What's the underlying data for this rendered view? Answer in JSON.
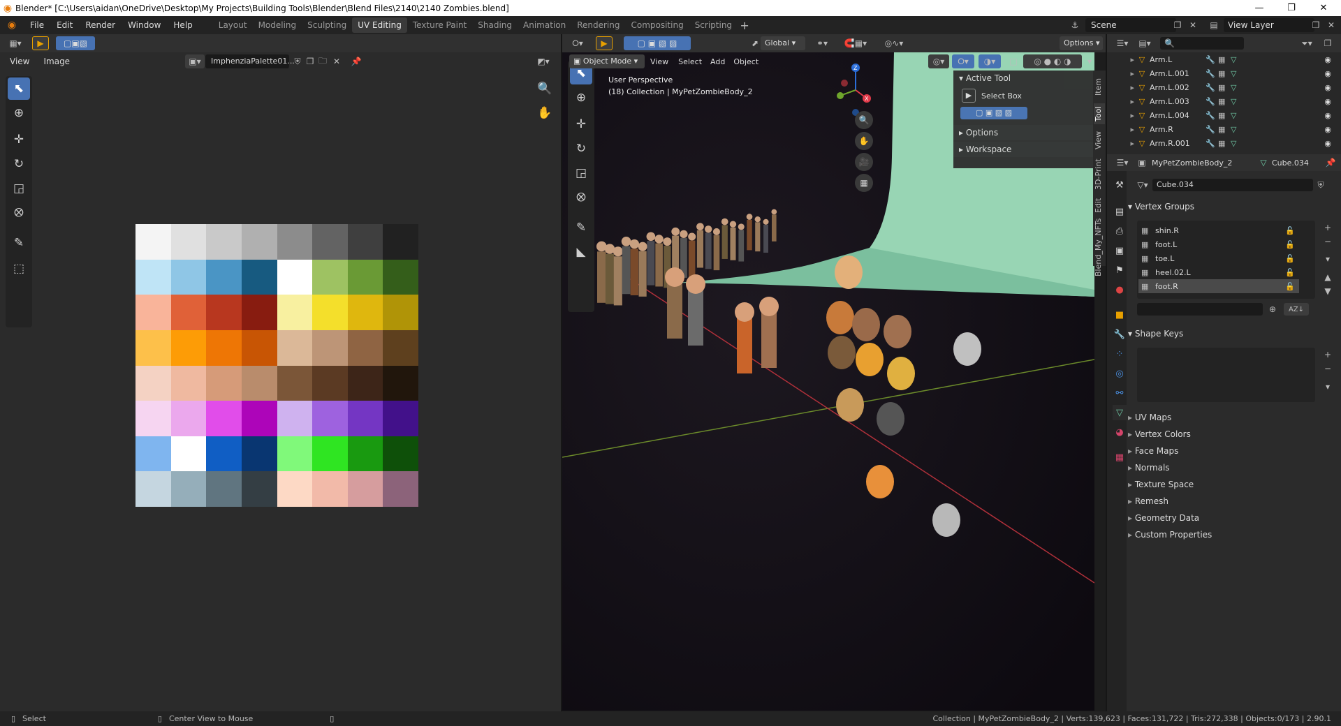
{
  "window": {
    "title": "Blender* [C:\\Users\\aidan\\OneDrive\\Desktop\\My Projects\\Building Tools\\Blender\\Blend Files\\2140\\2140 Zombies.blend]",
    "minimize_icon": "minimize-icon",
    "maximize_icon": "restore-icon",
    "close_icon": "close-icon"
  },
  "menu": [
    "File",
    "Edit",
    "Render",
    "Window",
    "Help"
  ],
  "workspaces": [
    "Layout",
    "Modeling",
    "Sculpting",
    "UV Editing",
    "Texture Paint",
    "Shading",
    "Animation",
    "Rendering",
    "Compositing",
    "Scripting"
  ],
  "active_workspace": "UV Editing",
  "add_workspace_icon": "plus-icon",
  "scene": "Scene",
  "view_layer": "View Layer",
  "image_editor": {
    "menu": [
      "View",
      "Image"
    ],
    "image_name": "ImphenziaPalette01...",
    "tools": [
      "select-box-icon",
      "cursor-icon",
      "move-icon",
      "rotate-icon",
      "scale-icon",
      "transform-icon",
      "annotate-icon",
      "grab-icon"
    ],
    "palette_colors": [
      [
        "#f4f4f4",
        "#e0e0e0",
        "#c9c9c9",
        "#b0b0b0",
        "#8c8c8c",
        "#636363",
        "#3f3f3f",
        "#212121"
      ],
      [
        "#bfe4f6",
        "#8fc6e6",
        "#4a95c5",
        "#175a80",
        "#ffffff",
        "#9ec262",
        "#6a9a35",
        "#345e1a"
      ],
      [
        "#f9b49a",
        "#e06138",
        "#b8371f",
        "#881c10",
        "#f8f0a0",
        "#f4df2b",
        "#dfb70e",
        "#b09407"
      ],
      [
        "#fdc04a",
        "#fd9c06",
        "#ee7605",
        "#c85504",
        "#dbb898",
        "#bd9577",
        "#8f6443",
        "#5e401e"
      ],
      [
        "#f4d2c3",
        "#efb9a0",
        "#d69b79",
        "#b98c6c",
        "#7b5638",
        "#5b3a23",
        "#3d2518",
        "#21160c"
      ],
      [
        "#f6d5f1",
        "#eba8ed",
        "#e14dea",
        "#ad05b9",
        "#cfb2ef",
        "#9e62df",
        "#7436c3",
        "#42118a"
      ],
      [
        "#7fb5ef",
        "#ffffff",
        "#105ec4",
        "#093671",
        "#80f97a",
        "#2fe522",
        "#199a10",
        "#0e5009"
      ],
      [
        "#c5d6e0",
        "#95aeba",
        "#607580",
        "#343e44",
        "#fdd9c5",
        "#f2baa9",
        "#d69d9e",
        "#8c637a"
      ]
    ]
  },
  "viewport": {
    "mode": "Object Mode",
    "menu": [
      "View",
      "Select",
      "Add",
      "Object"
    ],
    "orientation": "Global",
    "options_label": "Options",
    "perspective_label": "User Perspective",
    "collection_label": "(18) Collection | MyPetZombieBody_2",
    "side_tabs": [
      "Item",
      "Tool",
      "View",
      "3D-Print",
      "Edit",
      "Blend_My_NFTs"
    ],
    "active_tool_title": "Active Tool",
    "active_tool_name": "Select Box",
    "options_section": "Options",
    "workspace_section": "Workspace"
  },
  "outliner": {
    "items": [
      "Arm.L",
      "Arm.L.001",
      "Arm.L.002",
      "Arm.L.003",
      "Arm.L.004",
      "Arm.R",
      "Arm.R.001"
    ]
  },
  "properties": {
    "object_name": "MyPetZombieBody_2",
    "mesh_name": "Cube.034",
    "data_name": "Cube.034",
    "vertex_groups_title": "Vertex Groups",
    "vertex_groups": [
      "shin.R",
      "foot.L",
      "toe.L",
      "heel.02.L",
      "foot.R"
    ],
    "shape_keys_title": "Shape Keys",
    "sections": [
      "UV Maps",
      "Vertex Colors",
      "Face Maps",
      "Normals",
      "Texture Space",
      "Remesh",
      "Geometry Data",
      "Custom Properties"
    ]
  },
  "status": {
    "select": "Select",
    "center_view": "Center View to Mouse",
    "stats": "Collection | MyPetZombieBody_2 | Verts:139,623 | Faces:131,722 | Tris:272,338 | Objects:0/173 | 2.90.1"
  },
  "accent": "#4772b3",
  "viewport_backdrop_color": "#98d5b4"
}
